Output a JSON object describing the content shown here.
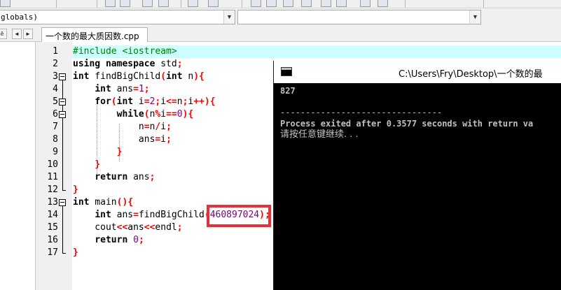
{
  "toolbar": {
    "icons": [
      "toolbar-button",
      "toolbar-button",
      "toolbar-button",
      "toolbar-button",
      "toolbar-button",
      "toolbar-button",
      "toolbar-button",
      "toolbar-button",
      "toolbar-button",
      "toolbar-button",
      "toolbar-button"
    ]
  },
  "combos": {
    "scope_value": "globals)",
    "member_value": ""
  },
  "tabs": {
    "nav_left_symbol": "◄",
    "nav_right_symbol": "►",
    "file_tab_label": "一个数的最大质因数.cpp"
  },
  "editor": {
    "line_numbers": [
      "1",
      "2",
      "3",
      "4",
      "5",
      "6",
      "7",
      "8",
      "9",
      "10",
      "11",
      "12",
      "13",
      "14",
      "15",
      "16",
      "17"
    ],
    "highlighted_argument": "460897024"
  },
  "console": {
    "title": "C:\\Users\\Fry\\Desktop\\一个数的最",
    "output_value": "827",
    "separator": "--------------------------------",
    "process_line": "Process exited after 0.3577 seconds with return va",
    "press_key_prompt": "请按任意键继续. . ."
  },
  "colors": {
    "highlight_box": "#e8303a",
    "current_line": "#ccffff",
    "keyword_symbol": "#ff0000",
    "number": "#800080",
    "preprocessor": "#008000"
  }
}
